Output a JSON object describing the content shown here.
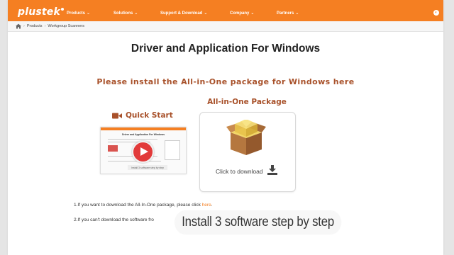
{
  "brand": {
    "logo_text": "plustek",
    "accent_color": "#f57f22",
    "heading_color": "#a8512a"
  },
  "nav": [
    {
      "label": "Products"
    },
    {
      "label": "Solutions"
    },
    {
      "label": "Support & Download"
    },
    {
      "label": "Company"
    },
    {
      "label": "Partners"
    }
  ],
  "nav_chevron": "⌄",
  "lang_icon": "globe-icon",
  "breadcrumb": {
    "items": [
      "Products",
      "Workgroup Scanners"
    ],
    "separator": "›"
  },
  "page": {
    "title": "Driver and Application For Windows",
    "subtitle": "Please install the All-in-One package for Windows here"
  },
  "quick_start": {
    "heading": "Quick Start",
    "thumbnail_title": "Driver and Application For Windows",
    "thumbnail_caption": "Install 3 software step by step"
  },
  "all_in_one": {
    "heading": "All-in-One Package",
    "download_label": "Click to download"
  },
  "instructions": {
    "line1_prefix": "1.If you want to download the All-In-One package, please click ",
    "line1_link": "here",
    "line1_suffix": ".",
    "line2_prefix": "2.If you can't download the software fro"
  },
  "overlay_caption": "Install 3 software step by step"
}
